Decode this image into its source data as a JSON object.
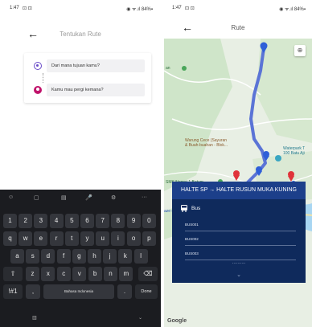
{
  "left_screen": {
    "status": {
      "time": "1:47",
      "icons_left": "⊡ ⊡",
      "right": "◉ ᯤ.ıl 84%▪"
    },
    "header": {
      "back": "←",
      "title": "Tentukan Rute"
    },
    "route": {
      "origin_placeholder": "Dari mana tujuan kamu?",
      "destination_placeholder": "Kamu mau pergi kemana?"
    },
    "keyboard": {
      "tools": [
        "☺",
        "▢",
        "▤",
        "🎤",
        "⚙",
        "···"
      ],
      "row_numbers": [
        "1",
        "2",
        "3",
        "4",
        "5",
        "6",
        "7",
        "8",
        "9",
        "0"
      ],
      "row_1": [
        "q",
        "w",
        "e",
        "r",
        "t",
        "y",
        "u",
        "i",
        "o",
        "p"
      ],
      "row_2": [
        "a",
        "s",
        "d",
        "f",
        "g",
        "h",
        "j",
        "k",
        "l"
      ],
      "row_3": [
        "z",
        "x",
        "c",
        "v",
        "b",
        "n",
        "m"
      ],
      "shift": "⇧",
      "backspace": "⌫",
      "symbols": "!#1",
      "comma": ",",
      "space": "Bahasa Indonesia",
      "period": ".",
      "done": "Done",
      "nav_left": "▥",
      "nav_right": "⌄"
    }
  },
  "right_screen": {
    "status": {
      "time": "1:47",
      "icons_left": "⊡ ⊡",
      "right": "◉ ᯤ.ıl 84%▪"
    },
    "header": {
      "back": "←",
      "title": "Rute"
    },
    "map": {
      "labels": {
        "top_left": "an",
        "warung": "Warung Cece (Sayuran\n& Buah-buahan - Blok...",
        "waterpark": "Waterpark T\n100 Batu Aji",
        "smk": "SMK Negeri 1 Batam",
        "halte": "aze dan Pasar"
      },
      "attribution": "Google",
      "colors": {
        "route": "#5b74d6",
        "water": "#a8d6f2",
        "marker_red": "#e0333a",
        "marker_blue": "#2f5fd8"
      }
    },
    "panel": {
      "title": "HALTE SP → HALTE RUSUN MUKA KUNING",
      "mode": "Bus",
      "buses": [
        "BUS001",
        "BUS002",
        "BUS003"
      ],
      "more": "..........",
      "toggle": "⌄"
    }
  }
}
